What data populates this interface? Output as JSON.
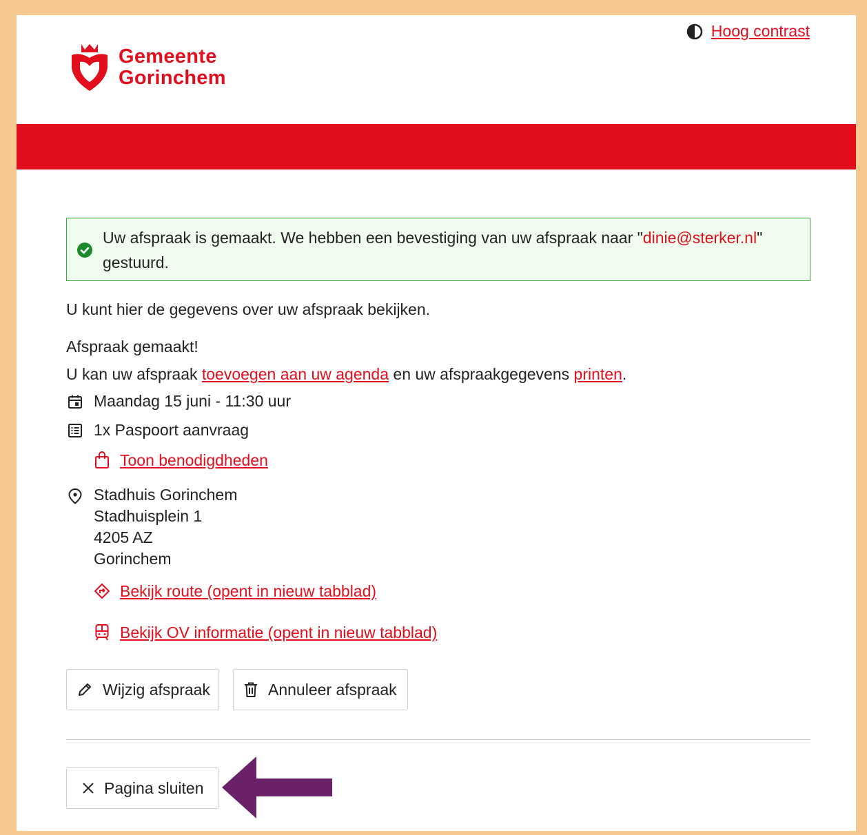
{
  "header": {
    "logo_line1": "Gemeente",
    "logo_line2": "Gorinchem",
    "contrast_label": "Hoog contrast"
  },
  "alert": {
    "text_before": "Uw afspraak is gemaakt. We hebben een bevestiging van uw afspraak naar \"",
    "email": "dinie@sterker.nl",
    "text_after": "\" gestuurd."
  },
  "content": {
    "intro": "U kunt hier de gegevens over uw afspraak bekijken.",
    "made": "Afspraak gemaakt!",
    "agenda_prefix": "U kan uw afspraak ",
    "agenda_link": "toevoegen aan uw agenda",
    "agenda_middle": " en uw afspraakgegevens ",
    "print_link": "printen",
    "agenda_suffix": ".",
    "date": "Maandag 15 juni - 11:30 uur",
    "product": "1x Paspoort aanvraag",
    "requirements_link": "Toon benodigdheden",
    "location": {
      "name": "Stadhuis Gorinchem",
      "street": "Stadhuisplein 1",
      "postcode": "4205 AZ",
      "city": "Gorinchem"
    },
    "route_link": "Bekijk route (opent in nieuw tabblad)",
    "ov_link": "Bekijk OV informatie (opent in nieuw tabblad)"
  },
  "buttons": {
    "edit": "Wijzig afspraak",
    "cancel": "Annuleer afspraak",
    "close": "Pagina sluiten"
  },
  "colors": {
    "brand_red": "#e30e1d",
    "frame": "#f5c88f",
    "success_border": "#3aa83a",
    "success_bg": "#f0fdee",
    "annotation_arrow": "#6a2168"
  },
  "icons": [
    "contrast-icon",
    "gorinchem-logo",
    "check-circle-icon",
    "calendar-icon",
    "list-icon",
    "bag-icon",
    "location-pin-icon",
    "route-icon",
    "bus-icon",
    "pencil-icon",
    "trash-icon",
    "close-icon",
    "arrow-annotation"
  ]
}
